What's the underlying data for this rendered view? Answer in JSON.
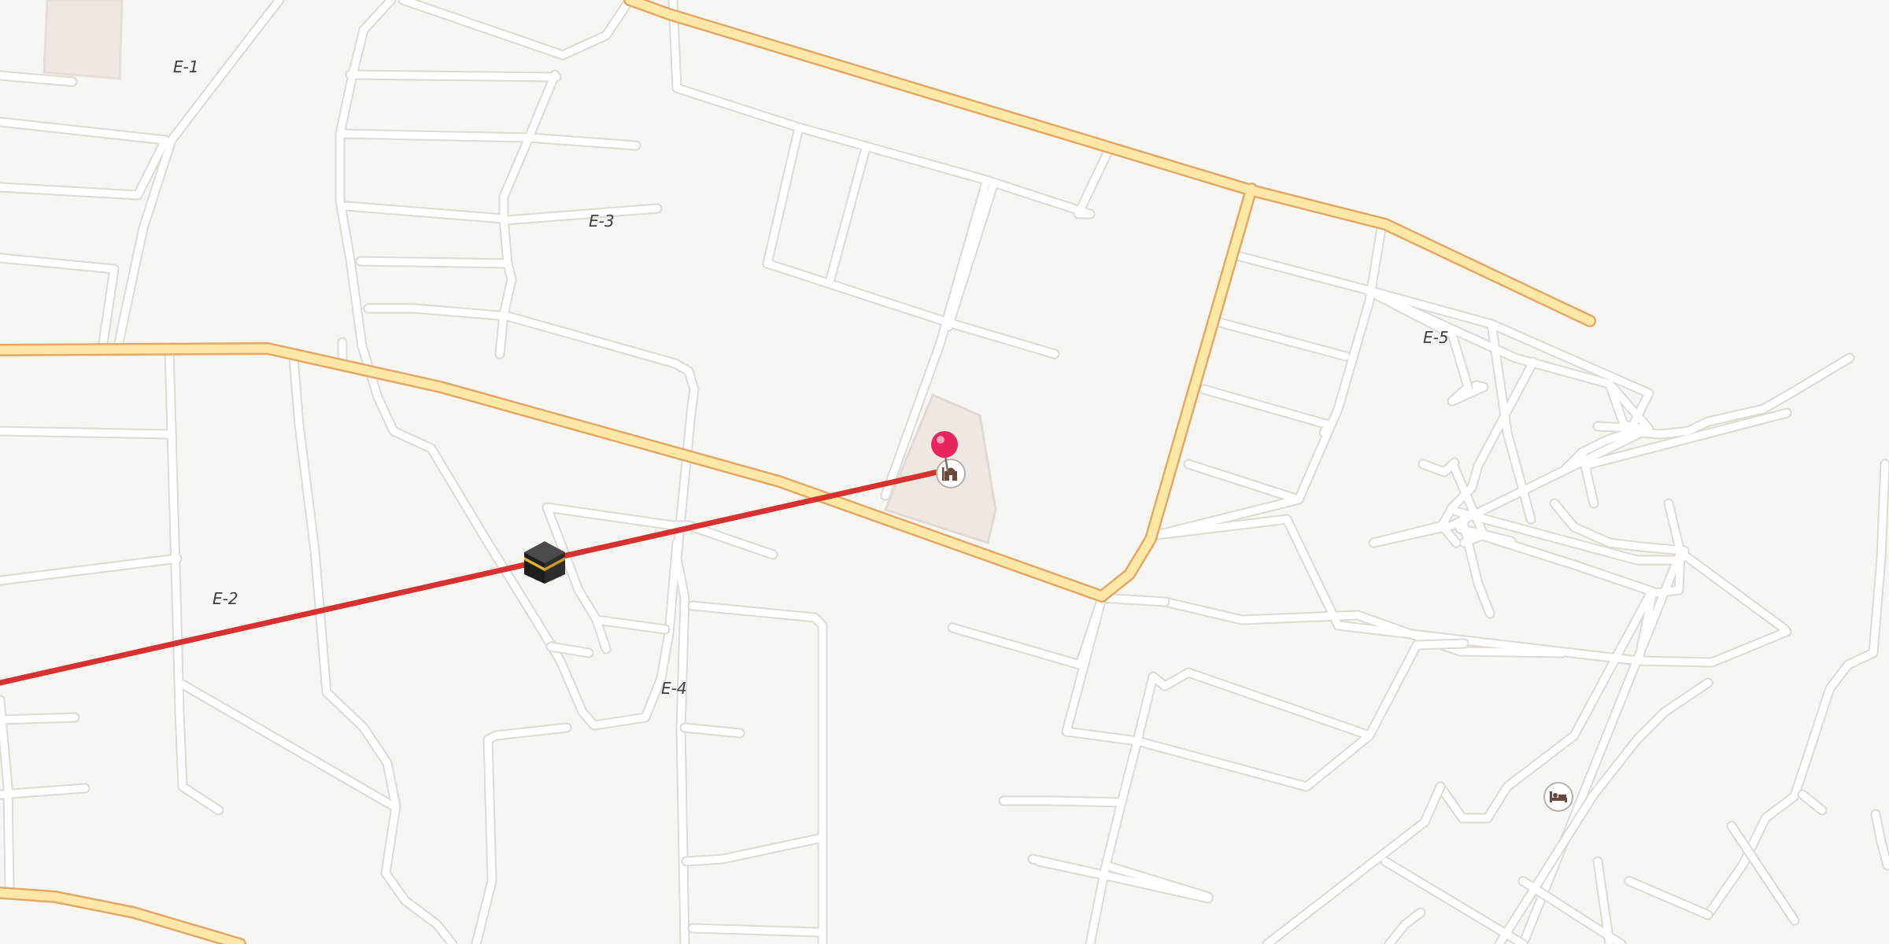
{
  "map": {
    "district_labels": [
      "E-1",
      "E-2",
      "E-3",
      "E-4",
      "E-5"
    ],
    "markers": {
      "destination_pin": {
        "icon": "red-location-pin-icon",
        "color": "#e6245e"
      },
      "poi_mosque": {
        "icon": "mosque-icon"
      },
      "poi_hotel": {
        "icon": "bed-icon"
      },
      "landmark_kaaba": {
        "icon": "kaaba-icon"
      }
    },
    "route": {
      "color": "#d93030"
    },
    "colors": {
      "background": "#f8f6f2",
      "minor_road": "#ffffff",
      "main_road": "#fde8a6",
      "main_road_border": "#e5a866",
      "area_fill": "#efe7e2"
    }
  }
}
